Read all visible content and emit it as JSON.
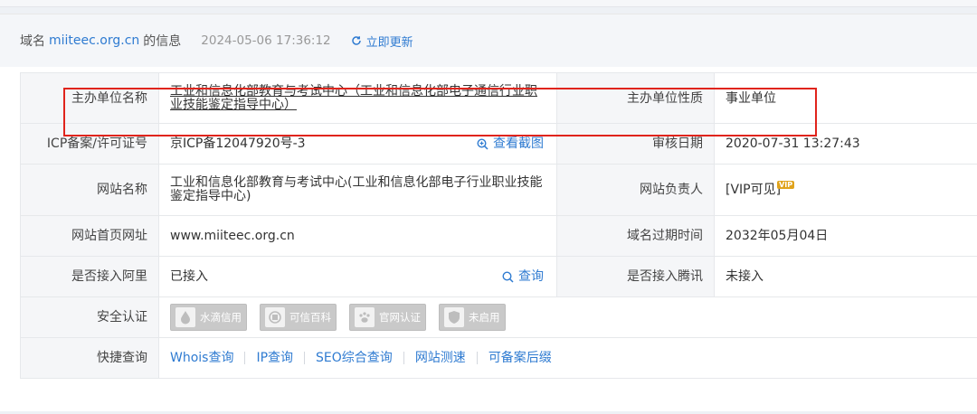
{
  "header": {
    "prefix": "域名",
    "domain": "miiteec.org.cn",
    "suffix": "的信息",
    "timestamp": "2024-05-06 17:36:12",
    "refresh_label": "立即更新"
  },
  "rows": {
    "sponsor_name_label": "主办单位名称",
    "sponsor_name_value": "工业和信息化部教育与考试中心（工业和信息化部电子通信行业职业技能鉴定指导中心）",
    "sponsor_type_label": "主办单位性质",
    "sponsor_type_value": "事业单位",
    "icp_label": "ICP备案/许可证号",
    "icp_value": "京ICP备12047920号-3",
    "screenshot_action": "查看截图",
    "review_date_label": "审核日期",
    "review_date_value": "2020-07-31 13:27:43",
    "site_name_label": "网站名称",
    "site_name_value": "工业和信息化部教育与考试中心(工业和信息化部电子行业职业技能鉴定指导中心)",
    "site_owner_label": "网站负责人",
    "site_owner_value": "[VIP可见]",
    "vip_badge": "VIP",
    "homepage_label": "网站首页网址",
    "homepage_value": "www.miiteec.org.cn",
    "domain_expiry_label": "域名过期时间",
    "domain_expiry_value": "2032年05月04日",
    "aliyun_label": "是否接入阿里",
    "aliyun_value": "已接入",
    "aliyun_query": "查询",
    "tencent_label": "是否接入腾讯",
    "tencent_value": "未接入",
    "security_label": "安全认证",
    "security_badges": [
      "水滴信用",
      "可信百科",
      "官网认证",
      "未启用"
    ],
    "quick_label": "快捷查询",
    "quick_links": [
      "Whois查询",
      "IP查询",
      "SEO综合查询",
      "网站测速",
      "可备案后缀"
    ]
  },
  "colors": {
    "link": "#2f7bd1",
    "highlight_box": "#e0241c",
    "label_bg": "#f5f6f8"
  }
}
